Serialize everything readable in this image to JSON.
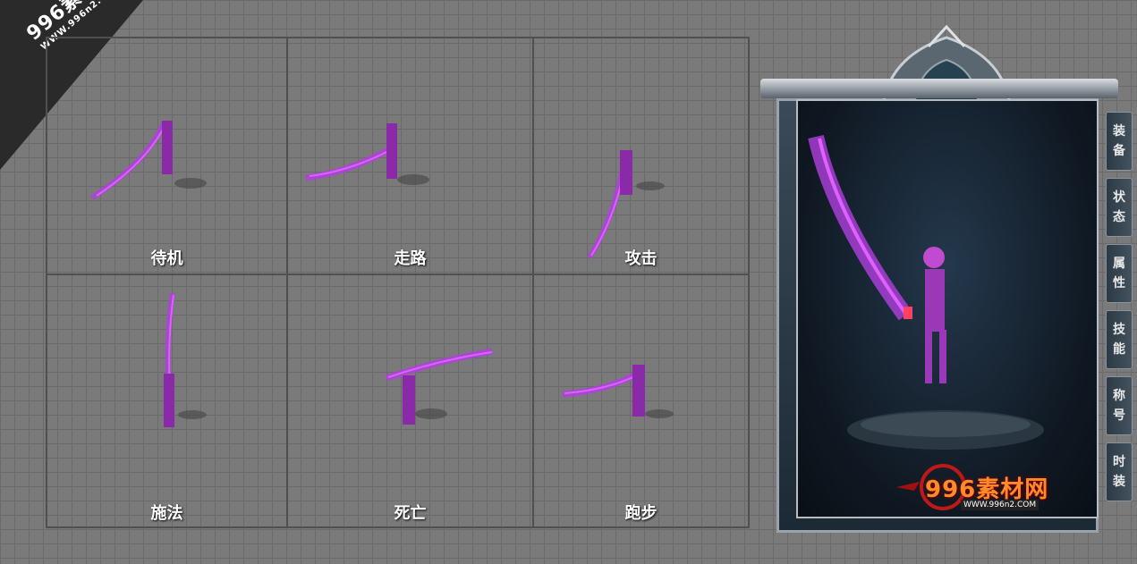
{
  "watermark": {
    "brand": "996素材网",
    "url": "WWW.996n2.COM"
  },
  "animations": [
    {
      "label": "待机"
    },
    {
      "label": "走路"
    },
    {
      "label": "攻击"
    },
    {
      "label": "施法"
    },
    {
      "label": "死亡"
    },
    {
      "label": "跑步"
    }
  ],
  "preview_tabs": [
    {
      "label": "装备",
      "chars": [
        "装",
        "备"
      ]
    },
    {
      "label": "状态",
      "chars": [
        "状",
        "态"
      ]
    },
    {
      "label": "属性",
      "chars": [
        "属",
        "性"
      ]
    },
    {
      "label": "技能",
      "chars": [
        "技",
        "能"
      ]
    },
    {
      "label": "称号",
      "chars": [
        "称",
        "号"
      ]
    },
    {
      "label": "时装",
      "chars": [
        "时",
        "装"
      ]
    }
  ],
  "logo": {
    "brand": "996素材网",
    "url": "WWW.996n2.COM"
  },
  "colors": {
    "weapon": "#b040e0",
    "weapon_glow": "#e060ff",
    "accent": "#ff4060"
  }
}
